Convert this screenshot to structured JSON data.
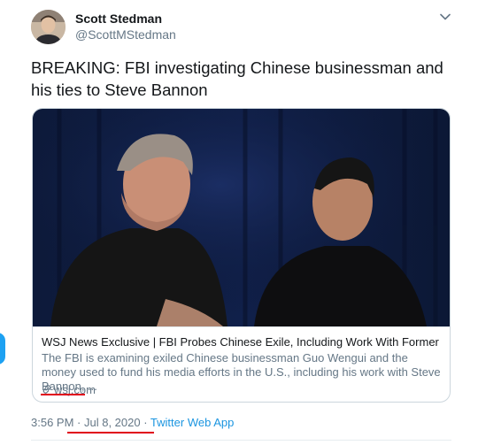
{
  "author": {
    "name": "Scott Stedman",
    "handle": "@ScottMStedman"
  },
  "tweet": {
    "text": "BREAKING: FBI investigating Chinese businessman and his ties to Steve Bannon"
  },
  "card": {
    "title": "WSJ News Exclusive | FBI Probes Chinese Exile, Including Work With Former Trum...",
    "description": "The FBI is examining exiled Chinese businessman Guo Wengui and the money used to fund his media efforts in the U.S., including his work with Steve Bannon, ...",
    "domain": "wsj.com"
  },
  "meta": {
    "time": "3:56 PM",
    "separator1": " · ",
    "date": "Jul 8, 2020",
    "separator2": " · ",
    "app": "Twitter Web App"
  },
  "colors": {
    "accent": "#1da1f2",
    "link": "#1b95e0",
    "secondary_text": "#657786",
    "annotation_underline": "#e0001b"
  },
  "icons": [
    "chevron-down-icon",
    "link-icon"
  ]
}
